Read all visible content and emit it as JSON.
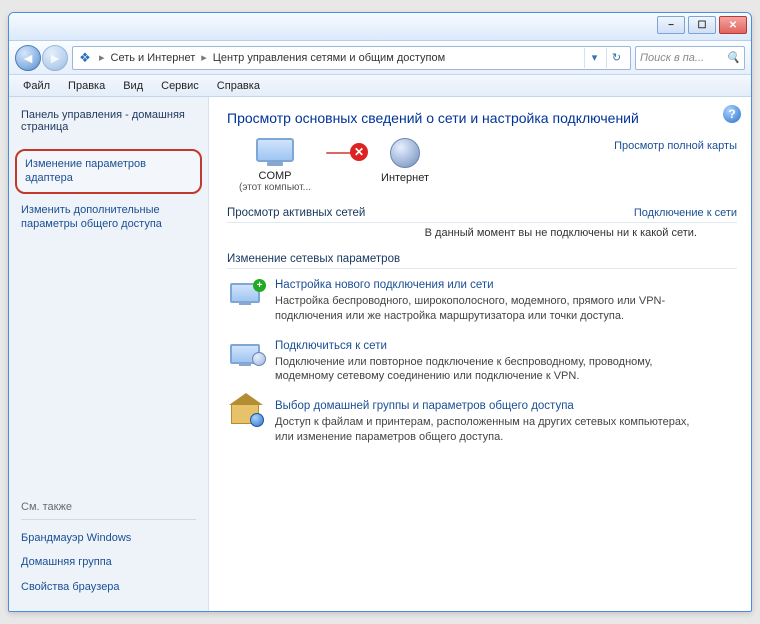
{
  "win_btns": {
    "min": "−",
    "max": "☐",
    "close": "✕"
  },
  "breadcrumb": {
    "seg1": "Сеть и Интернет",
    "seg2": "Центр управления сетями и общим доступом"
  },
  "search_placeholder": "Поиск в па...",
  "menu": {
    "file": "Файл",
    "edit": "Правка",
    "view": "Вид",
    "service": "Сервис",
    "help": "Справка"
  },
  "sidebar": {
    "home": "Панель управления - домашняя страница",
    "adapter": "Изменение параметров адаптера",
    "advanced": "Изменить дополнительные параметры общего доступа",
    "see_also": "См. также",
    "firewall": "Брандмауэр Windows",
    "homegroup": "Домашняя группа",
    "browser": "Свойства браузера"
  },
  "page": {
    "heading": "Просмотр основных сведений о сети и настройка подключений",
    "full_map": "Просмотр полной карты",
    "net_comp": "COMP",
    "net_comp_sub": "(этот компьют...",
    "net_internet": "Интернет",
    "active_title": "Просмотр активных сетей",
    "active_link": "Подключение к сети",
    "active_sub": "В данный момент вы не подключены ни к какой сети.",
    "change_title": "Изменение сетевых параметров",
    "opt1_title": "Настройка нового подключения или сети",
    "opt1_desc": "Настройка беспроводного, широкополосного, модемного, прямого или VPN-подключения или же настройка маршрутизатора или точки доступа.",
    "opt2_title": "Подключиться к сети",
    "opt2_desc": "Подключение или повторное подключение к беспроводному, проводному, модемному сетевому соединению или подключение к VPN.",
    "opt3_title": "Выбор домашней группы и параметров общего доступа",
    "opt3_desc": "Доступ к файлам и принтерам, расположенным на других сетевых компьютерах, или изменение параметров общего доступа."
  }
}
